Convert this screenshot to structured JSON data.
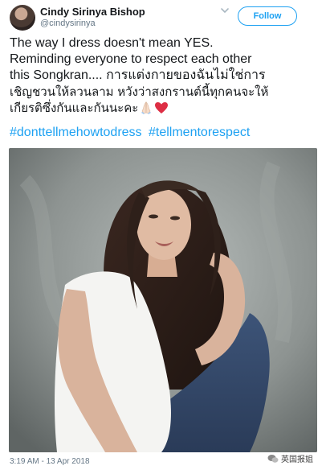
{
  "profile": {
    "name": "Cindy Sirinya Bishop",
    "handle": "@cindysirinya",
    "follow_label": "Follow"
  },
  "tweet": {
    "lines": [
      "The way I dress doesn't mean YES.",
      "Reminding everyone to respect each other",
      "this Songkran.... การแต่งกายของฉันไม่ใช่การ",
      "เชิญชวนให้ลวนลาม หวังว่าสงกรานต์นี้ทุกคนจะให้",
      "เกียรติซึ่งกันและกันนะคะ"
    ],
    "emojis": [
      "folded-hands-icon",
      "heart-icon"
    ],
    "hashtags": [
      "#donttellmehowtodress",
      "#tellmentorespect"
    ]
  },
  "photo": {
    "subject": "photo-of-woman"
  },
  "meta": {
    "timestamp": "3:19 AM - 13 Apr 2018"
  },
  "watermark": {
    "text": "英国报姐"
  },
  "colors": {
    "link": "#1da1f2",
    "text": "#14171a",
    "secondary": "#657786"
  }
}
